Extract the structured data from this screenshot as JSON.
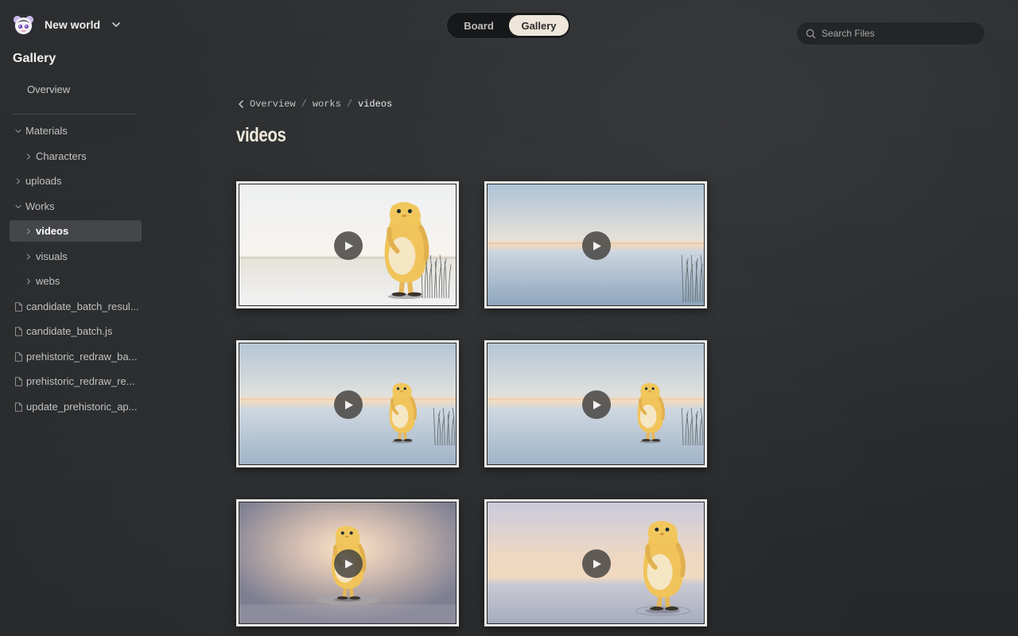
{
  "workspace": {
    "name": "New world",
    "logo_icon": "app-logo-icon"
  },
  "sidebar": {
    "title": "Gallery",
    "overview_label": "Overview",
    "tree": [
      {
        "label": "Materials",
        "type": "folder",
        "expanded": true,
        "depth": 0
      },
      {
        "label": "Characters",
        "type": "folder",
        "expanded": false,
        "depth": 1
      },
      {
        "label": "uploads",
        "type": "folder",
        "expanded": false,
        "depth": 0
      },
      {
        "label": "Works",
        "type": "folder",
        "expanded": true,
        "depth": 0
      },
      {
        "label": "videos",
        "type": "folder",
        "expanded": false,
        "depth": 1,
        "active": true
      },
      {
        "label": "visuals",
        "type": "folder",
        "expanded": false,
        "depth": 1
      },
      {
        "label": "webs",
        "type": "folder",
        "expanded": false,
        "depth": 1
      },
      {
        "label": "candidate_batch_resul...",
        "type": "file",
        "depth": 0
      },
      {
        "label": "candidate_batch.js",
        "type": "file",
        "depth": 0
      },
      {
        "label": "prehistoric_redraw_ba...",
        "type": "file",
        "depth": 0
      },
      {
        "label": "prehistoric_redraw_re...",
        "type": "file",
        "depth": 0
      },
      {
        "label": "update_prehistoric_ap...",
        "type": "file",
        "depth": 0
      }
    ]
  },
  "view_toggle": {
    "options": [
      "Board",
      "Gallery"
    ],
    "selected": "Gallery"
  },
  "search": {
    "placeholder": "Search Files",
    "value": ""
  },
  "breadcrumb": {
    "items": [
      "Overview",
      "works",
      "videos"
    ]
  },
  "page": {
    "title": "videos"
  },
  "gallery": {
    "items": [
      {
        "kind": "video",
        "scene": "character-right-lake"
      },
      {
        "kind": "video",
        "scene": "empty-lake"
      },
      {
        "kind": "video",
        "scene": "small-character-lake"
      },
      {
        "kind": "video",
        "scene": "small-character-lake"
      },
      {
        "kind": "video",
        "scene": "character-center-glow"
      },
      {
        "kind": "video",
        "scene": "character-right-ripples"
      }
    ]
  },
  "colors": {
    "background": "#2a2c2e",
    "accent_toggle": "#eee6db",
    "active_item": "#444649"
  }
}
